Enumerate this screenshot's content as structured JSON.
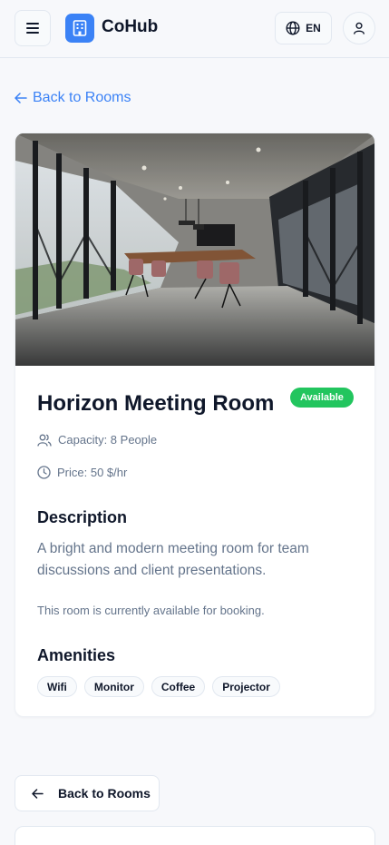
{
  "header": {
    "brand": "CoHub",
    "language": "EN",
    "icons": {
      "menu": "menu-icon",
      "logo": "building-icon",
      "language": "globe-icon",
      "user": "user-icon"
    }
  },
  "nav": {
    "back_link_label": "Back to Rooms",
    "back_button_label": "Back to Rooms"
  },
  "room": {
    "name": "Horizon Meeting Room",
    "status": "Available",
    "capacity": "Capacity: 8 People",
    "price": "Price: 50 $/hr",
    "description_heading": "Description",
    "description": "A bright and modern meeting room for team discussions and client presentations.",
    "availability_note": "This room is currently available for booking.",
    "amenities_heading": "Amenities",
    "amenities": [
      "Wifi",
      "Monitor",
      "Coffee",
      "Projector"
    ]
  },
  "colors": {
    "accent": "#3b82f6",
    "status_available": "#22c55e",
    "text": "#0f172a",
    "muted": "#64748b",
    "border": "#e2e8f0"
  }
}
